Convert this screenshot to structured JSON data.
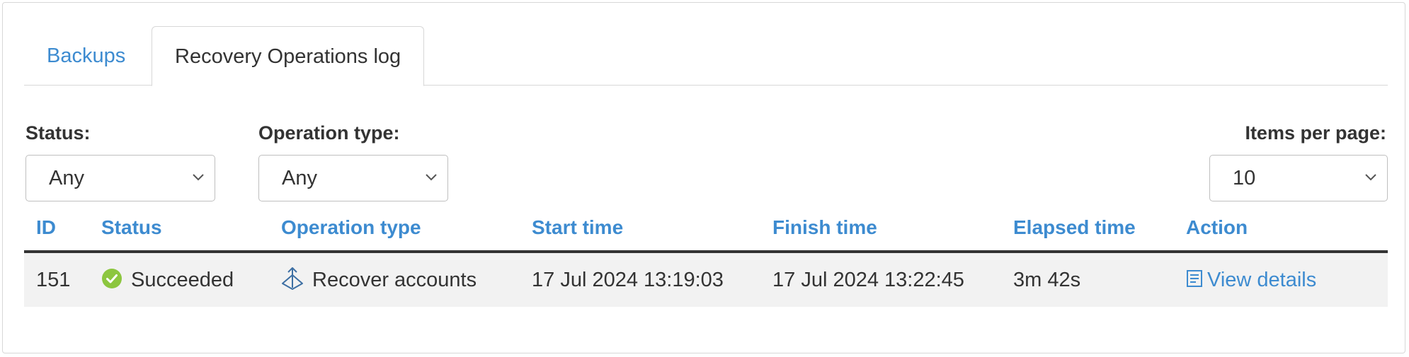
{
  "tabs": [
    {
      "label": "Backups",
      "active": false
    },
    {
      "label": "Recovery Operations log",
      "active": true
    }
  ],
  "filters": {
    "status": {
      "label": "Status:",
      "value": "Any"
    },
    "operation_type": {
      "label": "Operation type:",
      "value": "Any"
    },
    "items_per_page": {
      "label": "Items per page:",
      "value": "10"
    }
  },
  "table": {
    "columns": [
      "ID",
      "Status",
      "Operation type",
      "Start time",
      "Finish time",
      "Elapsed time",
      "Action"
    ],
    "rows": [
      {
        "id": "151",
        "status": "Succeeded",
        "status_icon": "check-circle-icon",
        "operation_type": "Recover accounts",
        "operation_icon": "recover-icon",
        "start_time": "17 Jul 2024 13:19:03",
        "finish_time": "17 Jul 2024 13:22:45",
        "elapsed_time": "3m 42s",
        "action": "View details",
        "action_icon": "details-icon"
      }
    ]
  },
  "colors": {
    "link": "#3d8bd0",
    "success": "#8cc63f",
    "text": "#333333",
    "border": "#d7d7d7",
    "row_bg": "#f2f2f2"
  }
}
